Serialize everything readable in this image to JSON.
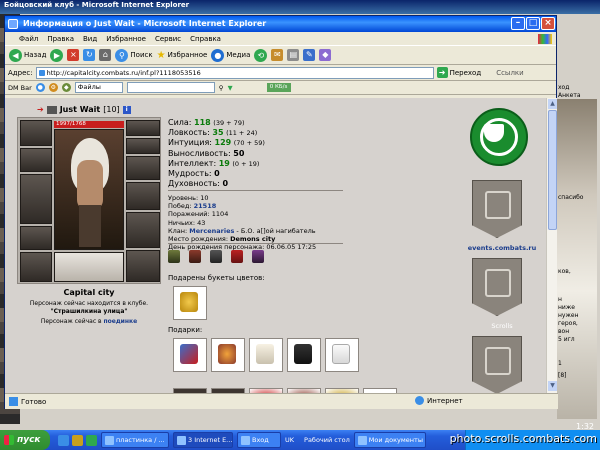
{
  "background_window": {
    "title": "Бойцовский клуб - Microsoft Internet Explorer",
    "side_labels": [
      "ход",
      "Анкета",
      "спасибо",
      "ков,",
      "ниже",
      "н",
      "нужен",
      "героя,",
      "вон",
      "5 игл",
      "1",
      "[8]"
    ]
  },
  "window": {
    "title": "Информация о Just Wait - Microsoft Internet Explorer",
    "menu": [
      "Файл",
      "Правка",
      "Вид",
      "Избранное",
      "Сервис",
      "Справка"
    ],
    "toolbar": {
      "back_label": "Назад",
      "search_label": "Поиск",
      "favorites_label": "Избранное",
      "media_label": "Медиа"
    },
    "address": {
      "label": "Адрес:",
      "url": "http://capitalcity.combats.ru/inf.pl?1118053516",
      "go_label": "Переход",
      "links_label": "Ссылки"
    },
    "dmbar": {
      "label": "DM Bar",
      "files_label": "Файлы",
      "kb_label": "0 КБ/s"
    },
    "status": {
      "left": "Готово",
      "zone": "Интернет"
    }
  },
  "character": {
    "name": "Just Wait",
    "level": "[10]",
    "hp": "1997/1768",
    "hp_fraction": 1.0,
    "city": "Capital city",
    "location_line": "Персонаж сейчас находится в клубе.",
    "room": "\"Страшилкина улица\"",
    "fight_line": "Персонаж сейчас в",
    "fight_link": "поединке"
  },
  "stats": [
    {
      "label": "Сила:",
      "value": "118",
      "bonus": "(39 + 79)",
      "color": "green"
    },
    {
      "label": "Ловкость:",
      "value": "35",
      "bonus": "(11 + 24)",
      "color": "green"
    },
    {
      "label": "Интуиция:",
      "value": "129",
      "bonus": "(70 + 59)",
      "color": "green"
    },
    {
      "label": "Выносливость:",
      "value": "50",
      "bonus": "",
      "color": "black"
    },
    {
      "label": "Интеллект:",
      "value": "19",
      "bonus": "(0 + 19)",
      "color": "green"
    },
    {
      "label": "Мудрость:",
      "value": "0",
      "bonus": "",
      "color": "black"
    },
    {
      "label": "Духовность:",
      "value": "0",
      "bonus": "",
      "color": "black"
    }
  ],
  "info": {
    "level_line": "Уровень: 10",
    "wins_label": "Побед:",
    "wins": "21518",
    "losses_line": "Поражений: 1104",
    "draws_line": "Ничьих: 43",
    "clan_label": "Клан:",
    "clan": "Mercenaries",
    "clan_rest": " - Б.О. a[]ой нагибатель",
    "birthplace_label": "Место рождения:",
    "birthplace": "Demons city",
    "birthday_line": "День рождения персонажа: 06.06.05 17:25"
  },
  "gifts": {
    "flowers_title": "Подарены букеты цветов:",
    "gifts_title": "Подарки:"
  },
  "sidebar": {
    "events_link": "events.combats.ru",
    "scrolls_link": "Scrolls"
  },
  "taskbar": {
    "start_label": "пуск",
    "tasks": [
      "пластинка / ...",
      "3 Internet E...",
      "Вход",
      "Рабочий стол",
      "Мои документы"
    ],
    "lang": "UK",
    "clock": "1:32"
  },
  "watermark": "photo.scrolls.combats.com",
  "colors": {
    "stat_green": "#0a7a0a",
    "link_blue": "#1a3c8c",
    "emblem_green": "#1a8c2e",
    "hp_red": "#c81e1e"
  }
}
